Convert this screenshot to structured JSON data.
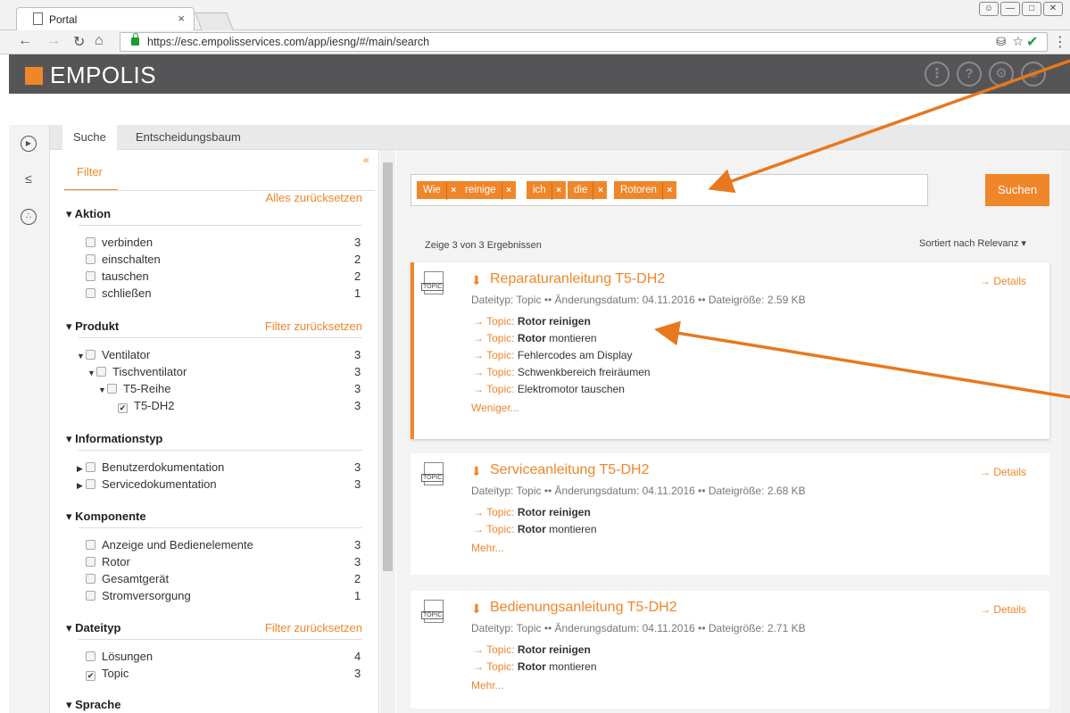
{
  "browser": {
    "tab_title": "Portal",
    "tab_close": "×",
    "url": "https://esc.empolisservices.com/app/iesng/#/main/search"
  },
  "app": {
    "logo": "EMPOLIS",
    "accent": "#f0862a",
    "header_icons": [
      "grid-icon",
      "help-icon",
      "settings-icon",
      "user-icon"
    ]
  },
  "tabs": [
    "Suche",
    "Entscheidungsbaum"
  ],
  "sidebar": {
    "filter_label": "Filter",
    "collapse": "«",
    "reset_all": "Alles zurücksetzen",
    "sections": [
      {
        "title": "Aktion",
        "reset": "",
        "items": [
          {
            "label": "verbinden",
            "count": "3",
            "checked": false
          },
          {
            "label": "einschalten",
            "count": "2",
            "checked": false
          },
          {
            "label": "tauschen",
            "count": "2",
            "checked": false
          },
          {
            "label": "schließen",
            "count": "1",
            "checked": false
          }
        ]
      },
      {
        "title": "Produkt",
        "reset": "Filter zurücksetzen",
        "items": [
          {
            "label": "Ventilator",
            "count": "3",
            "checked": false,
            "level": 0,
            "expand": "open"
          },
          {
            "label": "Tischventilator",
            "count": "3",
            "checked": false,
            "level": 1,
            "expand": "open"
          },
          {
            "label": "T5-Reihe",
            "count": "3",
            "checked": false,
            "level": 2,
            "expand": "open"
          },
          {
            "label": "T5-DH2",
            "count": "3",
            "checked": true,
            "level": 3,
            "expand": ""
          }
        ]
      },
      {
        "title": "Informationstyp",
        "reset": "",
        "items": [
          {
            "label": "Benutzerdokumentation",
            "count": "3",
            "checked": false,
            "expand": "closed"
          },
          {
            "label": "Servicedokumentation",
            "count": "3",
            "checked": false,
            "expand": "closed"
          }
        ]
      },
      {
        "title": "Komponente",
        "reset": "",
        "items": [
          {
            "label": "Anzeige und Bedienelemente",
            "count": "3",
            "checked": false
          },
          {
            "label": "Rotor",
            "count": "3",
            "checked": false
          },
          {
            "label": "Gesamtgerät",
            "count": "2",
            "checked": false
          },
          {
            "label": "Stromversorgung",
            "count": "1",
            "checked": false
          }
        ]
      },
      {
        "title": "Dateityp",
        "reset": "Filter zurücksetzen",
        "items": [
          {
            "label": "Lösungen",
            "count": "4",
            "checked": false
          },
          {
            "label": "Topic",
            "count": "3",
            "checked": true
          }
        ]
      },
      {
        "title": "Sprache",
        "reset": "",
        "items": []
      }
    ]
  },
  "search": {
    "chips": [
      "Wie",
      "reinige",
      "ich",
      "die",
      "Rotoren"
    ],
    "chip_remove": "×",
    "button": "Suchen"
  },
  "results": {
    "count_text": "Zeige 3 von 3 Ergebnissen",
    "sort_text": "Sortiert nach Relevanz ▾",
    "items": [
      {
        "icon_label": "TOPIC",
        "title": "Reparaturanleitung T5-DH2",
        "meta": "Dateityp: Topic •• Änderungsdatum: 04.11.2016 •• Dateigröße: 2.59 KB",
        "details": "→ Details",
        "topics": [
          {
            "prefix": "→ Topic:",
            "bold": "Rotor reinigen",
            "rest": ""
          },
          {
            "prefix": "→ Topic:",
            "bold": "Rotor",
            "rest": " montieren"
          },
          {
            "prefix": "→ Topic:",
            "bold": "",
            "rest": " Fehlercodes am Display"
          },
          {
            "prefix": "→ Topic:",
            "bold": "",
            "rest": " Schwenkbereich freiräumen"
          },
          {
            "prefix": "→ Topic:",
            "bold": "",
            "rest": " Elektromotor tauschen"
          }
        ],
        "more": "Weniger..."
      },
      {
        "icon_label": "TOPIC",
        "title": "Serviceanleitung T5-DH2",
        "meta": "Dateityp: Topic •• Änderungsdatum: 04.11.2016 •• Dateigröße: 2.68 KB",
        "details": "→ Details",
        "topics": [
          {
            "prefix": "→ Topic:",
            "bold": "Rotor reinigen",
            "rest": ""
          },
          {
            "prefix": "→ Topic:",
            "bold": "Rotor",
            "rest": " montieren"
          }
        ],
        "more": "Mehr..."
      },
      {
        "icon_label": "TOPIC",
        "title": "Bedienungsanleitung T5-DH2",
        "meta": "Dateityp: Topic •• Änderungsdatum: 04.11.2016 •• Dateigröße: 2.71 KB",
        "details": "→ Details",
        "topics": [
          {
            "prefix": "→ Topic:",
            "bold": "Rotor reinigen",
            "rest": ""
          },
          {
            "prefix": "→ Topic:",
            "bold": "Rotor",
            "rest": " montieren"
          }
        ],
        "more": "Mehr..."
      }
    ]
  }
}
